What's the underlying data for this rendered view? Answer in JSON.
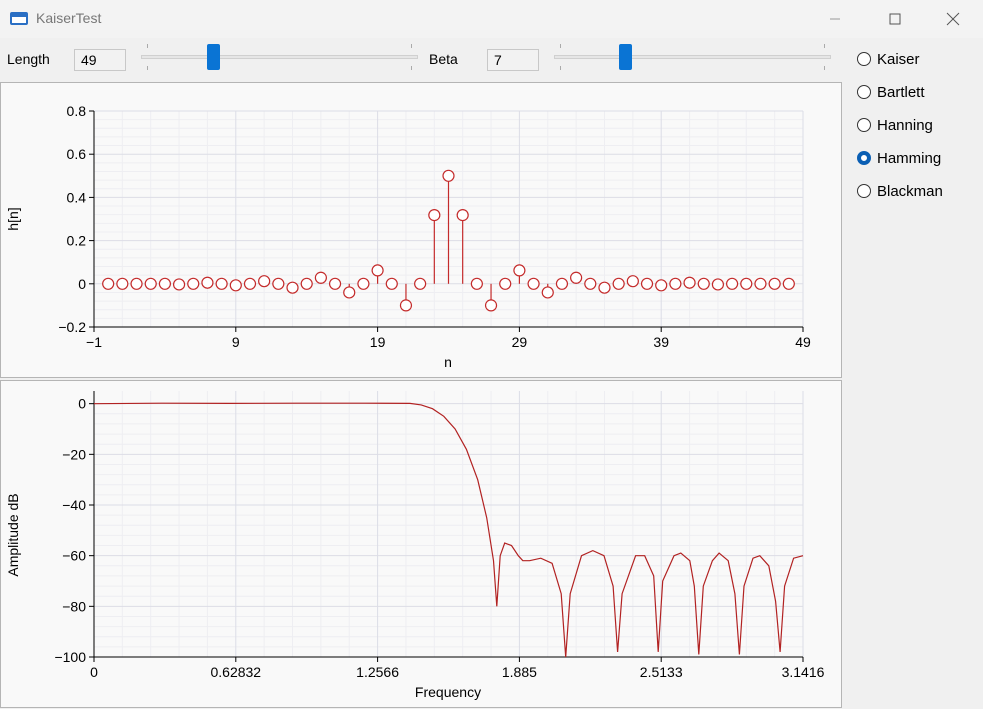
{
  "window": {
    "title": "KaiserTest",
    "minimize_icon": "minimize-icon",
    "maximize_icon": "maximize-icon",
    "close_icon": "close-icon"
  },
  "controls": {
    "length_label": "Length",
    "length_value": "49",
    "length_slider_fraction": 0.25,
    "beta_label": "Beta",
    "beta_value": "7",
    "beta_slider_fraction": 0.245
  },
  "window_types": [
    {
      "label": "Kaiser",
      "checked": false
    },
    {
      "label": "Bartlett",
      "checked": false
    },
    {
      "label": "Hanning",
      "checked": false
    },
    {
      "label": "Hamming",
      "checked": true
    },
    {
      "label": "Blackman",
      "checked": false
    }
  ],
  "chart_data": [
    {
      "type": "stem",
      "xlabel": "n",
      "ylabel": "h[n]",
      "xlim": [
        -1,
        49
      ],
      "ylim": [
        -0.2,
        0.8
      ],
      "xticks": [
        "−1",
        "9",
        "19",
        "29",
        "39",
        "49"
      ],
      "xtick_values": [
        -1,
        9,
        19,
        29,
        39,
        49
      ],
      "yticks": [
        "0.8",
        "0.6",
        "0.4",
        "0.2",
        "0",
        "−0.2"
      ],
      "ytick_values": [
        0.8,
        0.6,
        0.4,
        0.2,
        0,
        -0.2
      ],
      "color": "#c42b2b",
      "x": [
        0,
        1,
        2,
        3,
        4,
        5,
        6,
        7,
        8,
        9,
        10,
        11,
        12,
        13,
        14,
        15,
        16,
        17,
        18,
        19,
        20,
        21,
        22,
        23,
        24,
        25,
        26,
        27,
        28,
        29,
        30,
        31,
        32,
        33,
        34,
        35,
        36,
        37,
        38,
        39,
        40,
        41,
        42,
        43,
        44,
        45,
        46,
        47,
        48
      ],
      "values": [
        0,
        0,
        0,
        0,
        0,
        -0.003,
        0,
        0.005,
        0,
        -0.007,
        0,
        0.012,
        0,
        -0.018,
        0,
        0.028,
        0,
        -0.04,
        0,
        0.062,
        0,
        -0.1,
        0,
        0.318,
        0.5,
        0.318,
        0,
        -0.1,
        0,
        0.062,
        0,
        -0.04,
        0,
        0.028,
        0,
        -0.018,
        0,
        0.012,
        0,
        -0.007,
        0,
        0.005,
        0,
        -0.003,
        0,
        0,
        0,
        0,
        0
      ]
    },
    {
      "type": "line",
      "xlabel": "Frequency",
      "ylabel": "Amplitude dB",
      "xlim": [
        0,
        3.1416
      ],
      "ylim": [
        -100,
        5
      ],
      "xticks": [
        "0",
        "0.62832",
        "1.2566",
        "1.885",
        "2.5133",
        "3.1416"
      ],
      "xtick_values": [
        0,
        0.62832,
        1.2566,
        1.885,
        2.5133,
        3.1416
      ],
      "yticks": [
        "0",
        "−20",
        "−40",
        "−60",
        "−80",
        "−100"
      ],
      "ytick_values": [
        0,
        -20,
        -40,
        -60,
        -80,
        -100
      ],
      "color": "#b22222",
      "points": [
        [
          0,
          0
        ],
        [
          0.3,
          0.2
        ],
        [
          0.6,
          0.1
        ],
        [
          0.9,
          0.2
        ],
        [
          1.2,
          0.2
        ],
        [
          1.4,
          0.1
        ],
        [
          1.45,
          -0.5
        ],
        [
          1.5,
          -2
        ],
        [
          1.55,
          -5
        ],
        [
          1.6,
          -10
        ],
        [
          1.65,
          -18
        ],
        [
          1.7,
          -30
        ],
        [
          1.74,
          -45
        ],
        [
          1.77,
          -62
        ],
        [
          1.785,
          -80
        ],
        [
          1.8,
          -60
        ],
        [
          1.82,
          -55
        ],
        [
          1.85,
          -56
        ],
        [
          1.88,
          -60
        ],
        [
          1.9,
          -62
        ],
        [
          1.93,
          -62
        ],
        [
          1.98,
          -61
        ],
        [
          2.03,
          -63
        ],
        [
          2.07,
          -75
        ],
        [
          2.09,
          -100
        ],
        [
          2.11,
          -75
        ],
        [
          2.16,
          -60
        ],
        [
          2.21,
          -58
        ],
        [
          2.26,
          -60
        ],
        [
          2.3,
          -72
        ],
        [
          2.32,
          -98
        ],
        [
          2.34,
          -75
        ],
        [
          2.4,
          -60
        ],
        [
          2.44,
          -60
        ],
        [
          2.48,
          -68
        ],
        [
          2.5,
          -98
        ],
        [
          2.52,
          -70
        ],
        [
          2.57,
          -60
        ],
        [
          2.6,
          -59
        ],
        [
          2.64,
          -62
        ],
        [
          2.66,
          -72
        ],
        [
          2.68,
          -99
        ],
        [
          2.7,
          -72
        ],
        [
          2.74,
          -62
        ],
        [
          2.77,
          -59
        ],
        [
          2.81,
          -62
        ],
        [
          2.84,
          -75
        ],
        [
          2.86,
          -99
        ],
        [
          2.88,
          -72
        ],
        [
          2.92,
          -61
        ],
        [
          2.95,
          -60
        ],
        [
          2.99,
          -64
        ],
        [
          3.02,
          -78
        ],
        [
          3.04,
          -98
        ],
        [
          3.06,
          -72
        ],
        [
          3.1,
          -61
        ],
        [
          3.1416,
          -60
        ]
      ]
    }
  ]
}
